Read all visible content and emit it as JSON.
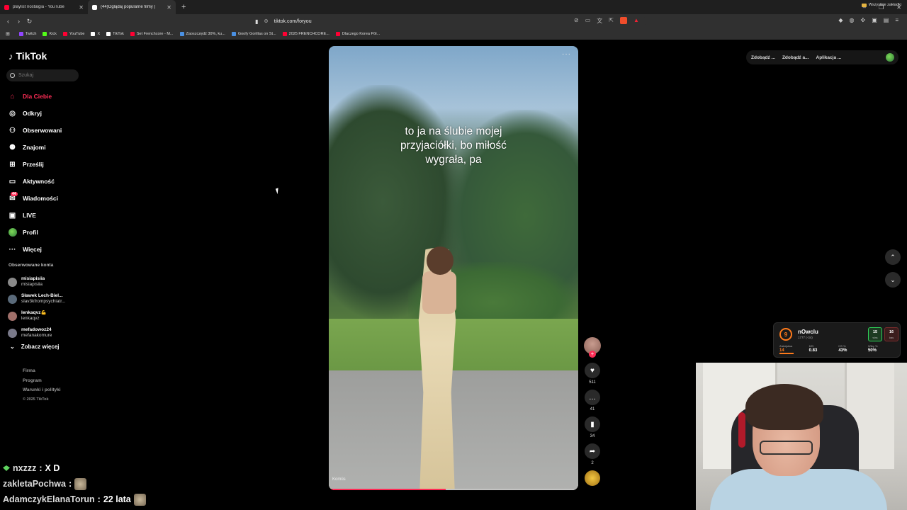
{
  "browser": {
    "tabs": [
      {
        "title": "playlist nostalgia - YouTube"
      },
      {
        "title": "(44)Oglądaj popularne filmy |"
      }
    ],
    "url": "tiktok.com/foryou",
    "bookmarks": [
      {
        "label": "Twitch",
        "color": "#9146ff"
      },
      {
        "label": "Kick",
        "color": "#53fc18"
      },
      {
        "label": "YouTube",
        "color": "#ff0033"
      },
      {
        "label": "X",
        "color": "#ffffff"
      },
      {
        "label": "TikTok",
        "color": "#ffffff"
      },
      {
        "label": "Set Frenchcore - M...",
        "color": "#ff0033"
      },
      {
        "label": "Zaoszczędź 30%, ku...",
        "color": "#4a90e2"
      },
      {
        "label": "Goofy Gorillas on St...",
        "color": "#4a90e2"
      },
      {
        "label": "2025 FRENCHCORE...",
        "color": "#ff0033"
      },
      {
        "label": "Dlaczego Korea Pół...",
        "color": "#ff0033"
      }
    ],
    "all_bookmarks": "Wszystkie zakładki"
  },
  "tiktok": {
    "brand": "TikTok",
    "search_placeholder": "Szukaj",
    "nav": [
      {
        "label": "Dla Ciebie",
        "icon": "home-icon",
        "active": true
      },
      {
        "label": "Odkryj",
        "icon": "compass-icon"
      },
      {
        "label": "Obserwowani",
        "icon": "following-icon"
      },
      {
        "label": "Znajomi",
        "icon": "friends-icon"
      },
      {
        "label": "Prześlij",
        "icon": "upload-icon"
      },
      {
        "label": "Aktywność",
        "icon": "activity-icon"
      },
      {
        "label": "Wiadomości",
        "icon": "messages-icon",
        "badge": "44"
      },
      {
        "label": "LIVE",
        "icon": "live-icon"
      },
      {
        "label": "Profil",
        "icon": "profile-icon"
      },
      {
        "label": "Więcej",
        "icon": "more-icon"
      }
    ],
    "following_title": "Obserwowane konta",
    "following": [
      {
        "name": "misiapisiia",
        "handle": "misiapisiia"
      },
      {
        "name": "Sławek Lech-Biel...",
        "handle": "slav3kfrompsychiatr..."
      },
      {
        "name": "lenkaqvz💪",
        "handle": "lenkaqvz"
      },
      {
        "name": "mefadowoz24",
        "handle": "mefanakomure"
      }
    ],
    "see_more": "Zobacz więcej",
    "footer": {
      "links": [
        "Firma",
        "Program",
        "Warunki i polityki"
      ],
      "copyright": "© 2025 TikTok"
    },
    "topbar": [
      "Zdobądź ...",
      "Zdobądź a...",
      "Aplikacja ..."
    ]
  },
  "video": {
    "caption_lines": [
      "to ja na ślubie mojej",
      "przyjaciółki, bo miłość",
      "wygrała, pa"
    ],
    "label": "Komüs",
    "progress": 0.47,
    "likes": "511",
    "comments": "41",
    "saves": "34",
    "shares": "2"
  },
  "faceit": {
    "level": "9",
    "name": "nOwclu",
    "elo": "1777 (-34)",
    "wins": "15",
    "wins_label": "wins",
    "losses": "16",
    "losses_label": "loss",
    "stats": [
      {
        "label": "Zabójstwa",
        "value": "14"
      },
      {
        "label": "K/D",
        "value": "0.83"
      },
      {
        "label": "HS %",
        "value": "43%"
      },
      {
        "label": "Wiby %",
        "value": "50%"
      }
    ]
  },
  "chat": [
    {
      "user": "nxzzz",
      "msg": "X D",
      "badge": true
    },
    {
      "user": "zakletaPochwa",
      "msg": "",
      "emote": true
    },
    {
      "user": "AdamczykElanaTorun",
      "msg": "22 lata",
      "emote": true
    }
  ]
}
